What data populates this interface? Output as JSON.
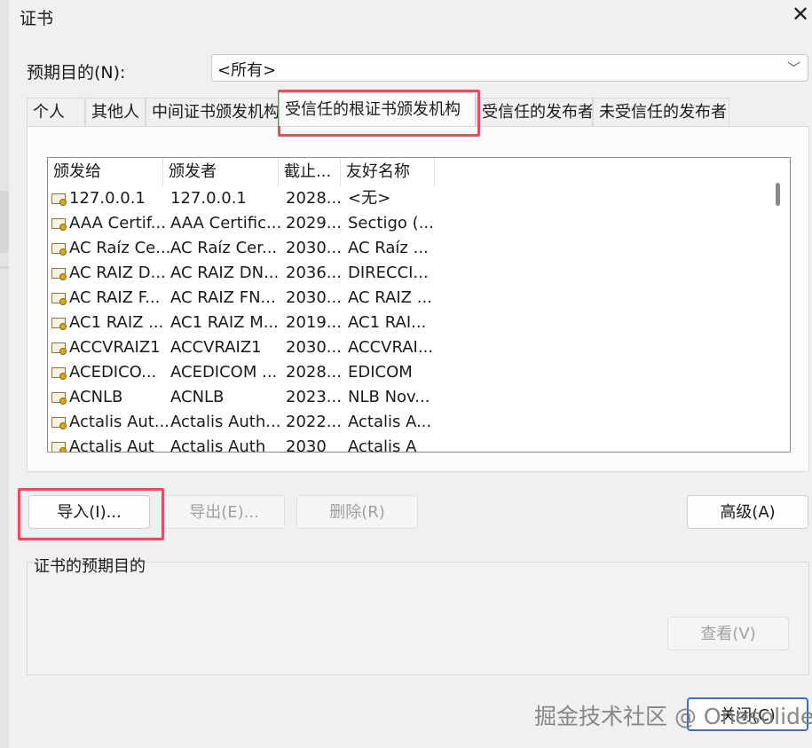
{
  "window": {
    "title": "证书"
  },
  "purpose": {
    "label": "预期目的(N):",
    "value": "<所有>"
  },
  "tabs": [
    {
      "label": "个人"
    },
    {
      "label": "其他人"
    },
    {
      "label": "中间证书颁发机构"
    },
    {
      "label": "受信任的根证书颁发机构",
      "active": true
    },
    {
      "label": "受信任的发布者"
    },
    {
      "label": "未受信任的发布者"
    }
  ],
  "list": {
    "columns": [
      "颁发给",
      "颁发者",
      "截止...",
      "友好名称"
    ],
    "rows": [
      [
        "127.0.0.1",
        "127.0.0.1",
        "2028...",
        "<无>"
      ],
      [
        "AAA Certif...",
        "AAA Certific...",
        "2029...",
        "Sectigo (..."
      ],
      [
        "AC Raíz Ce...",
        "AC Raíz Cer...",
        "2030...",
        "AC Raíz ..."
      ],
      [
        "AC RAIZ D...",
        "AC RAIZ DN...",
        "2036...",
        "DIRECCI..."
      ],
      [
        "AC RAIZ F...",
        "AC RAIZ FN...",
        "2030...",
        "AC RAIZ ..."
      ],
      [
        "AC1 RAIZ ...",
        "AC1 RAIZ M...",
        "2019...",
        "AC1 RAI..."
      ],
      [
        "ACCVRAIZ1",
        "ACCVRAIZ1",
        "2030...",
        "ACCVRAI..."
      ],
      [
        "ACEDICO...",
        "ACEDICOM ...",
        "2028...",
        "EDICOM"
      ],
      [
        "ACNLB",
        "ACNLB",
        "2023...",
        "NLB Nov..."
      ],
      [
        "Actalis Aut...",
        "Actalis Auth...",
        "2022...",
        "Actalis A..."
      ],
      [
        "Actalis Aut",
        "Actalis Auth",
        "2030",
        "Actalis A"
      ]
    ]
  },
  "buttons": {
    "import": "导入(I)...",
    "export": "导出(E)...",
    "delete": "删除(R)",
    "advanced": "高级(A)",
    "view": "查看(V)",
    "close": "关闭(C)"
  },
  "purposes_group": {
    "label": "证书的预期目的"
  },
  "watermark": "掘金技术社区 @ Onesolide",
  "colors": {
    "highlight": "#ee4b5a"
  },
  "icons": {
    "row_icon": "certificate-icon",
    "close": "close-icon",
    "dropdown": "chevron-down-icon"
  }
}
